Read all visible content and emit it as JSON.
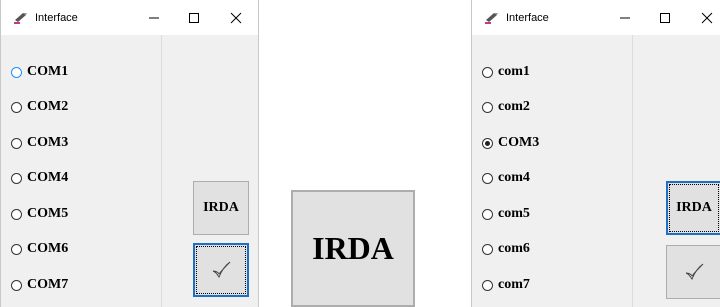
{
  "left_window": {
    "title": "Interface",
    "radios": [
      {
        "label": "COM1",
        "checked": false,
        "focused": true
      },
      {
        "label": "COM2",
        "checked": false
      },
      {
        "label": "COM3",
        "checked": false
      },
      {
        "label": "COM4",
        "checked": false
      },
      {
        "label": "COM5",
        "checked": false
      },
      {
        "label": "COM6",
        "checked": false
      },
      {
        "label": "COM7",
        "checked": false
      }
    ],
    "irda_label": "IRDA",
    "ok_icon": "checkmark-icon"
  },
  "zoom": {
    "irda_label": "IRDA"
  },
  "right_window": {
    "title": "Interface",
    "radios": [
      {
        "label": "com1",
        "checked": false
      },
      {
        "label": "com2",
        "checked": false
      },
      {
        "label": "COM3",
        "checked": true
      },
      {
        "label": "com4",
        "checked": false
      },
      {
        "label": "com5",
        "checked": false
      },
      {
        "label": "com6",
        "checked": false
      },
      {
        "label": "com7",
        "checked": false
      }
    ],
    "irda_label": "IRDA",
    "ok_icon": "checkmark-icon"
  }
}
